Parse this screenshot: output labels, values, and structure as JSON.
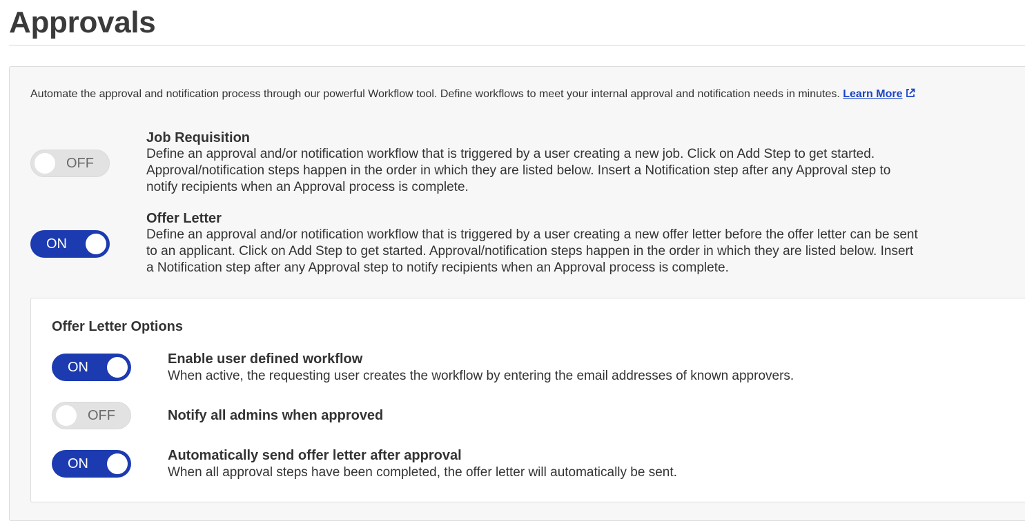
{
  "page": {
    "title": "Approvals"
  },
  "intro": {
    "text": "Automate the approval and notification process through our powerful Workflow tool. Define workflows to meet your internal approval and notification needs in minutes.",
    "link_label": "Learn More",
    "link_icon": "external-link-icon"
  },
  "settings": [
    {
      "title": "Job Requisition",
      "state": "OFF",
      "description": "Define an approval and/or notification workflow that is triggered by a user creating a new job. Click on Add Step to get started. Approval/notification steps happen in the order in which they are listed below. Insert a Notification step after any Approval step to notify recipients when an Approval process is complete."
    },
    {
      "title": "Offer Letter",
      "state": "ON",
      "description": "Define an approval and/or notification workflow that is triggered by a user creating a new offer letter before the offer letter can be sent to an applicant. Click on Add Step to get started. Approval/notification steps happen in the order in which they are listed below. Insert a Notification step after any Approval step to notify recipients when an Approval process is complete."
    }
  ],
  "offer_options": {
    "title": "Offer Letter Options",
    "items": [
      {
        "title": "Enable user defined workflow",
        "state": "ON",
        "description": "When active, the requesting user creates the workflow by entering the email addresses of known approvers."
      },
      {
        "title": "Notify all admins when approved",
        "state": "OFF",
        "description": ""
      },
      {
        "title": "Automatically send offer letter after approval",
        "state": "ON",
        "description": "When all approval steps have been completed, the offer letter will automatically be sent."
      }
    ]
  },
  "colors": {
    "toggle_on": "#1c3bb0",
    "toggle_off": "#e2e2e2",
    "link": "#1a44c6"
  }
}
